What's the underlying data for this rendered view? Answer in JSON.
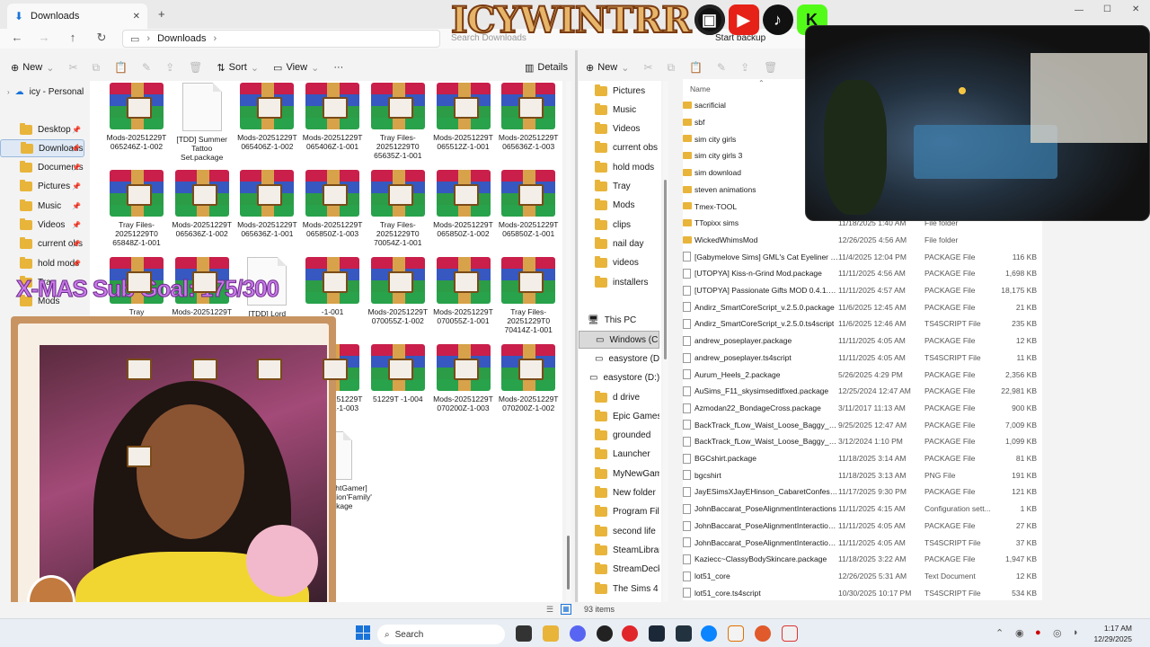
{
  "titlebar": {
    "tab_title": "Downloads",
    "close_glyph": "✕",
    "new_tab_glyph": "+",
    "window_controls": [
      "—",
      "☐",
      "✕"
    ]
  },
  "address": {
    "crumb": "Downloads",
    "search_placeholder": "Search Downloads"
  },
  "toolbar_left": {
    "new": "New",
    "sort": "Sort",
    "view": "View",
    "more": "···",
    "details": "Details"
  },
  "toolbar_right": {
    "new": "New",
    "start_backup": "Start backup"
  },
  "sidebar_left": {
    "root": "icy - Personal",
    "items": [
      "Desktop",
      "Downloads",
      "Documents",
      "Pictures",
      "Music",
      "Videos",
      "current obs fi",
      "hold mods",
      "Tray",
      "Mods"
    ]
  },
  "grid_files": [
    {
      "name": "Mods-20251229T 065246Z-1-002",
      "kind": "rar"
    },
    {
      "name": "[TDD] Summer Tattoo Set.package",
      "kind": "doc"
    },
    {
      "name": "Mods-20251229T 065406Z-1-002",
      "kind": "rar"
    },
    {
      "name": "Mods-20251229T 065406Z-1-001",
      "kind": "rar"
    },
    {
      "name": "Tray Files-20251229T0 65635Z-1-001",
      "kind": "rar"
    },
    {
      "name": "Mods-20251229T 065512Z-1-001",
      "kind": "rar"
    },
    {
      "name": "Mods-20251229T 065636Z-1-003",
      "kind": "rar"
    },
    {
      "name": "Tray Files-20251229T0 65848Z-1-001",
      "kind": "rar"
    },
    {
      "name": "Mods-20251229T 065636Z-1-002",
      "kind": "rar"
    },
    {
      "name": "Mods-20251229T 065636Z-1-001",
      "kind": "rar"
    },
    {
      "name": "Mods-20251229T 065850Z-1-003",
      "kind": "rar"
    },
    {
      "name": "Tray Files-20251229T0 70054Z-1-001",
      "kind": "rar"
    },
    {
      "name": "Mods-20251229T 065850Z-1-002",
      "kind": "rar"
    },
    {
      "name": "Mods-20251229T 065850Z-1-001",
      "kind": "rar"
    },
    {
      "name": "Tray",
      "kind": "rar"
    },
    {
      "name": "Mods-20251229T",
      "kind": "rar"
    },
    {
      "name": "[TDD] Lord",
      "kind": "doc"
    },
    {
      "name": "-1-001",
      "kind": "rar"
    },
    {
      "name": "Mods-20251229T 070055Z-1-002",
      "kind": "rar"
    },
    {
      "name": "Mods-20251229T 070055Z-1-001",
      "kind": "rar"
    },
    {
      "name": "Tray Files-20251229T0 70414Z-1-001",
      "kind": "rar"
    },
    {
      "name": "1229T -1-003",
      "kind": "rar"
    },
    {
      "name": "Mods-20251229T 070415Z-1-001",
      "kind": "rar"
    },
    {
      "name": "Mods-20251229T 070415Z-1-002",
      "kind": "rar"
    },
    {
      "name": "Mods-20251229T 070454Z-1-003",
      "kind": "rar"
    },
    {
      "name": "51229T -1-004",
      "kind": "rar"
    },
    {
      "name": "Mods-20251229T 070200Z-1-003",
      "kind": "rar"
    },
    {
      "name": "Mods-20251229T 070200Z-1-002",
      "kind": "rar"
    },
    {
      "name": "Mods-20251229T 070200Z-1-001",
      "kind": "rar"
    },
    {
      "name": "rcedes ach - rs",
      "kind": "doc"
    },
    {
      "name": "(Ex) Mercedes S650 Maybach - doors 2 (1).package",
      "kind": "doc"
    },
    {
      "name": "[ShineBrightGamer] CarAnimation'Family' (1).package",
      "kind": "doc"
    }
  ],
  "sidebar_right": {
    "quick": [
      "Pictures",
      "Music",
      "Videos",
      "current obs fi",
      "hold mods",
      "Tray",
      "Mods",
      "clips",
      "nail day",
      "videos",
      "installers"
    ],
    "this_pc": "This PC",
    "drives": [
      "Windows (C:)",
      "easystore (D:)",
      "easystore (D:)"
    ],
    "d_folders": [
      "d drive",
      "Epic Games",
      "grounded",
      "Launcher",
      "MyNewGame",
      "New folder",
      "Program Files",
      "second life",
      "SteamLibrary",
      "StreamDeck",
      "The Sims 4"
    ]
  },
  "details": {
    "header_name": "Name",
    "rows": [
      {
        "name": "sacrificial",
        "date": "",
        "type": "",
        "size": "",
        "kind": "folder"
      },
      {
        "name": "sbf",
        "date": "",
        "type": "",
        "size": "",
        "kind": "folder"
      },
      {
        "name": "sim city girls",
        "date": "",
        "type": "",
        "size": "",
        "kind": "folder"
      },
      {
        "name": "sim city girls 3",
        "date": "",
        "type": "",
        "size": "",
        "kind": "folder"
      },
      {
        "name": "sim download",
        "date": "",
        "type": "",
        "size": "",
        "kind": "folder"
      },
      {
        "name": "steven animations",
        "date": "",
        "type": "",
        "size": "",
        "kind": "folder"
      },
      {
        "name": "Tmex-TOOL",
        "date": "",
        "type": "",
        "size": "",
        "kind": "folder"
      },
      {
        "name": "TTopixx sims",
        "date": "11/18/2025 1:40 AM",
        "type": "File folder",
        "size": "",
        "kind": "folder"
      },
      {
        "name": "WickedWhimsMod",
        "date": "12/26/2025 4:56 AM",
        "type": "File folder",
        "size": "",
        "kind": "folder"
      },
      {
        "name": "[Gabymelove Sims] GML's Cat Eyeliner • ...",
        "date": "11/4/2025 12:04 PM",
        "type": "PACKAGE File",
        "size": "116 KB",
        "kind": "file"
      },
      {
        "name": "[UTOPYA] Kiss-n-Grind Mod.package",
        "date": "11/11/2025 4:56 AM",
        "type": "PACKAGE File",
        "size": "1,698 KB",
        "kind": "file"
      },
      {
        "name": "[UTOPYA] Passionate Gifts MOD 0.4.1.pa...",
        "date": "11/11/2025 4:57 AM",
        "type": "PACKAGE File",
        "size": "18,175 KB",
        "kind": "file"
      },
      {
        "name": "Andirz_SmartCoreScript_v.2.5.0.package",
        "date": "11/6/2025 12:45 AM",
        "type": "PACKAGE File",
        "size": "21 KB",
        "kind": "file"
      },
      {
        "name": "Andirz_SmartCoreScript_v.2.5.0.ts4script",
        "date": "11/6/2025 12:46 AM",
        "type": "TS4SCRIPT File",
        "size": "235 KB",
        "kind": "file"
      },
      {
        "name": "andrew_poseplayer.package",
        "date": "11/11/2025 4:05 AM",
        "type": "PACKAGE File",
        "size": "12 KB",
        "kind": "file"
      },
      {
        "name": "andrew_poseplayer.ts4script",
        "date": "11/11/2025 4:05 AM",
        "type": "TS4SCRIPT File",
        "size": "11 KB",
        "kind": "file"
      },
      {
        "name": "Aurum_Heels_2.package",
        "date": "5/26/2025 4:29 PM",
        "type": "PACKAGE File",
        "size": "2,356 KB",
        "kind": "file"
      },
      {
        "name": "AuSims_F11_skysimseditfixed.package",
        "date": "12/25/2024 12:47 AM",
        "type": "PACKAGE File",
        "size": "22,981 KB",
        "kind": "file"
      },
      {
        "name": "Azmodan22_BondageCross.package",
        "date": "3/11/2017 11:13 AM",
        "type": "PACKAGE File",
        "size": "900 KB",
        "kind": "file"
      },
      {
        "name": "BackTrack_fLow_Waist_Loose_Baggy_De...",
        "date": "9/25/2025 12:47 AM",
        "type": "PACKAGE File",
        "size": "7,009 KB",
        "kind": "file"
      },
      {
        "name": "BackTrack_fLow_Waist_Loose_Baggy_De...",
        "date": "3/12/2024 1:10 PM",
        "type": "PACKAGE File",
        "size": "1,099 KB",
        "kind": "file"
      },
      {
        "name": "BGCshirt.package",
        "date": "11/18/2025 3:14 AM",
        "type": "PACKAGE File",
        "size": "81 KB",
        "kind": "file"
      },
      {
        "name": "bgcshirt",
        "date": "11/18/2025 3:13 AM",
        "type": "PNG File",
        "size": "191 KB",
        "kind": "file"
      },
      {
        "name": "JayESimsXJayEHinson_CabaretConfessio...",
        "date": "11/17/2025 9:30 PM",
        "type": "PACKAGE File",
        "size": "121 KB",
        "kind": "file"
      },
      {
        "name": "JohnBaccarat_PoseAlignmentInteractions",
        "date": "11/11/2025 4:15 AM",
        "type": "Configuration sett...",
        "size": "1 KB",
        "kind": "file"
      },
      {
        "name": "JohnBaccarat_PoseAlignmentInteraction...",
        "date": "11/11/2025 4:05 AM",
        "type": "PACKAGE File",
        "size": "27 KB",
        "kind": "file"
      },
      {
        "name": "JohnBaccarat_PoseAlignmentInteraction...",
        "date": "11/11/2025 4:05 AM",
        "type": "TS4SCRIPT File",
        "size": "37 KB",
        "kind": "file"
      },
      {
        "name": "Kaziecc~ClassyBodySkincare.package",
        "date": "11/18/2025 3:22 AM",
        "type": "PACKAGE File",
        "size": "1,947 KB",
        "kind": "file"
      },
      {
        "name": "lot51_core",
        "date": "12/26/2025 5:31 AM",
        "type": "Text Document",
        "size": "12 KB",
        "kind": "file"
      },
      {
        "name": "lot51_core.ts4script",
        "date": "10/30/2025 10:17 PM",
        "type": "TS4SCRIPT File",
        "size": "534 KB",
        "kind": "file"
      }
    ]
  },
  "status": {
    "count": "93 items"
  },
  "overlay": {
    "brand": "ICYWINTRR",
    "goal": "X-MAS Sub Goal: 175/300",
    "social": [
      "twitch-icon",
      "youtube-icon",
      "tiktok-icon",
      "kick-icon"
    ]
  },
  "taskbar": {
    "search_label": "Search",
    "time": "1:17 AM",
    "date": "12/29/2025"
  },
  "colors": {
    "folder": "#e8b43a",
    "accent": "#1a73d9",
    "goal": "#c879e8"
  }
}
